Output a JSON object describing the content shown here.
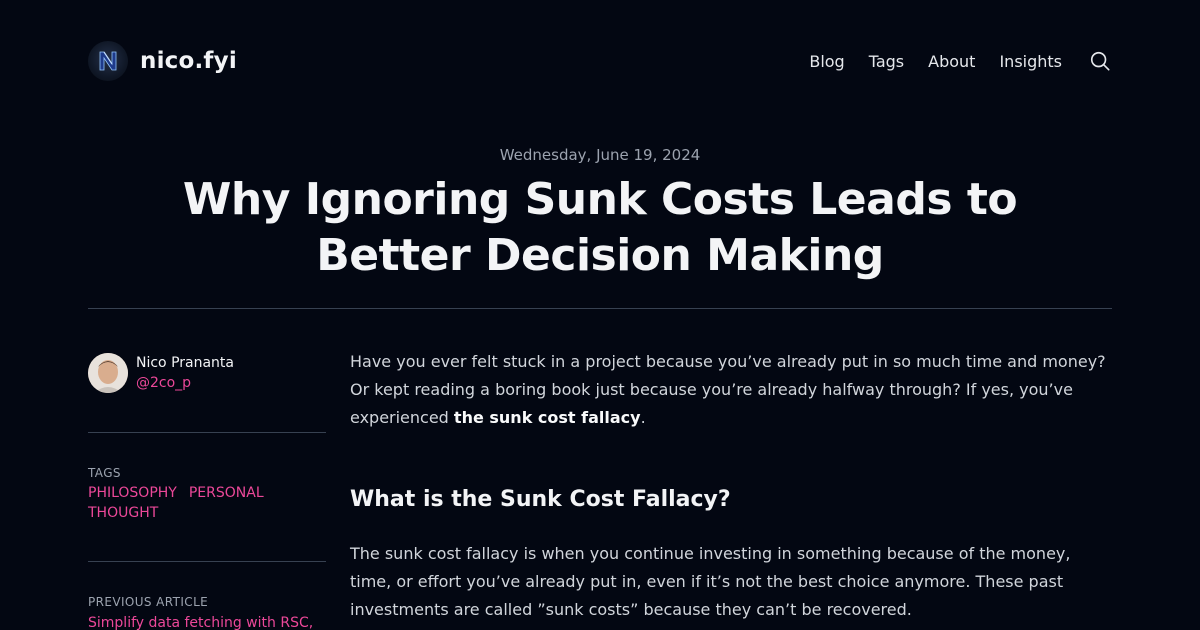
{
  "site": {
    "name": "nico.fyi",
    "nav": [
      "Blog",
      "Tags",
      "About",
      "Insights"
    ]
  },
  "post": {
    "date": "Wednesday, June 19, 2024",
    "title": "Why Ignoring Sunk Costs Leads to Better Decision Making",
    "author": {
      "name": "Nico Prananta",
      "handle": "@2co_p"
    },
    "tags_label": "TAGS",
    "tags": [
      "PHILOSOPHY",
      "PERSONAL",
      "THOUGHT"
    ],
    "previous_label": "PREVIOUS ARTICLE",
    "previous_title": "Simplify data fetching with RSC, Suspense, and use API in Next.js"
  },
  "content": {
    "intro_before": "Have you ever felt stuck in a project because you’ve already put in so much time and money? Or kept reading a boring book just because you’re already halfway through? If yes, you’ve experienced ",
    "intro_bold": "the sunk cost fallacy",
    "intro_after": ".",
    "heading": "What is the Sunk Cost Fallacy?",
    "paragraph2": "The sunk cost fallacy is when you continue investing in something because of the money, time, or effort you’ve already put in, even if it’s not the best choice anymore. These past investments are called ”sunk costs” because they can’t be recovered."
  },
  "icons": {
    "logo": "n-logo-icon",
    "search": "search-icon"
  },
  "colors": {
    "background": "#030712",
    "accent": "#ec4899",
    "muted": "#9ca3af"
  }
}
